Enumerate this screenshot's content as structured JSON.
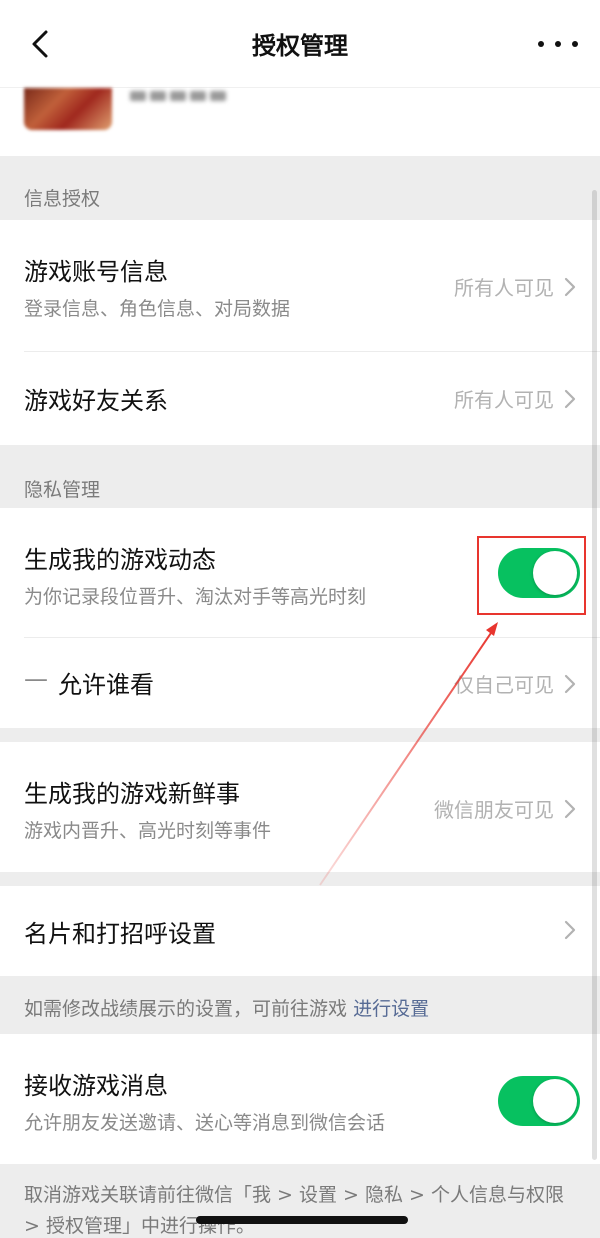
{
  "nav": {
    "title": "授权管理",
    "back_icon": "chevron-left-icon",
    "more_icon": "more-dots-icon"
  },
  "profile": {
    "avatar_icon": "avatar-blurred",
    "nickname_blurred": true
  },
  "sections": {
    "info_auth_title": "信息授权",
    "privacy_title": "隐私管理"
  },
  "rows": {
    "account_info": {
      "title": "游戏账号信息",
      "subtitle": "登录信息、角色信息、对局数据",
      "value": "所有人可见"
    },
    "friend_relation": {
      "title": "游戏好友关系",
      "value": "所有人可见"
    },
    "game_moments": {
      "title": "生成我的游戏动态",
      "subtitle": "为你记录段位晋升、淘汰对手等高光时刻",
      "toggle_on": true
    },
    "who_can_see": {
      "dash": "—",
      "title": "允许谁看",
      "value": "仅自己可见"
    },
    "game_news": {
      "title": "生成我的游戏新鲜事",
      "subtitle": "游戏内晋升、高光时刻等事件",
      "value": "微信朋友可见"
    },
    "card_greeting": {
      "title": "名片和打招呼设置"
    },
    "receive_messages": {
      "title": "接收游戏消息",
      "subtitle": "允许朋友发送邀请、送心等消息到微信会话",
      "toggle_on": true
    }
  },
  "notes": {
    "record_prefix": "如需修改战绩展示的设置，可前往游戏",
    "record_link": "进行设置",
    "footer": "取消游戏关联请前往微信「我 > 设置 > 隐私 > 个人信息与权限 > 授权管理」中进行操作。"
  },
  "colors": {
    "toggle_on": "#07c160",
    "link": "#576b95",
    "annotation_red": "#e8352e",
    "background": "#ededed"
  }
}
